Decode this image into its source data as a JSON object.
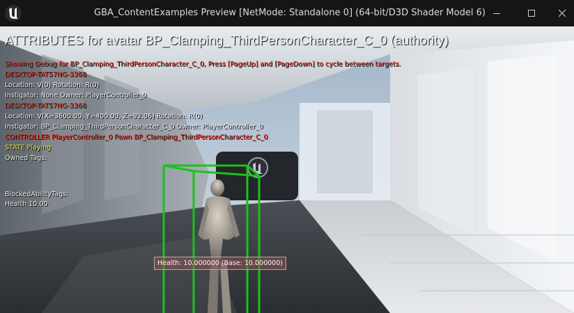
{
  "window": {
    "title": "GBA_ContentExamples Preview [NetMode: Standalone 0]  (64-bit/D3D Shader Model 6)",
    "logo_icon": "unreal-engine-logo-icon",
    "controls": {
      "minimize_icon": "minimize-icon",
      "maximize_icon": "maximize-icon",
      "close_icon": "close-icon"
    }
  },
  "debug": {
    "header": "ATTRIBUTES for avatar BP_Clamping_ThirdPersonCharacter_C_0 (authority)",
    "lines": [
      {
        "text": "Showing Debug for BP_Clamping_ThirdPersonCharacter_C_0, Press [PageUp] and [PageDown] to cycle between targets.",
        "color": "red"
      },
      {
        "text": "DESKTOP-TAT57NG-3368",
        "color": "red"
      },
      {
        "text": "Location: V(0) Rotation: R(0)",
        "color": "white"
      },
      {
        "text": " Instigator: None Owner: PlayerController_0",
        "color": "white"
      },
      {
        "text": "DESKTOP-TAT57NG-3368",
        "color": "red"
      },
      {
        "text": "Location: V(X=3600.00, Y=400.00, Z=92.06) Rotation: R(0)",
        "color": "white"
      },
      {
        "text": " Instigator: BP_Clamping_ThirdPersonCharacter_C_0 Owner: PlayerController_0",
        "color": "white"
      },
      {
        "text": "CONTROLLER PlayerController_0 Pawn BP_Clamping_ThirdPersonCharacter_C_0",
        "color": "red"
      },
      {
        "text": "STATE Playing",
        "color": "yellow"
      },
      {
        "text": "Owned Tags:",
        "color": "white"
      }
    ],
    "blocked_tags": "BlockedAbilityTags:",
    "health": "Health 10.00"
  },
  "world": {
    "health_label": "Health: 10.000000 (Base: 10.000000)",
    "bounds_color": "#18c418",
    "wall_logo_icon": "unreal-engine-logo-icon"
  }
}
